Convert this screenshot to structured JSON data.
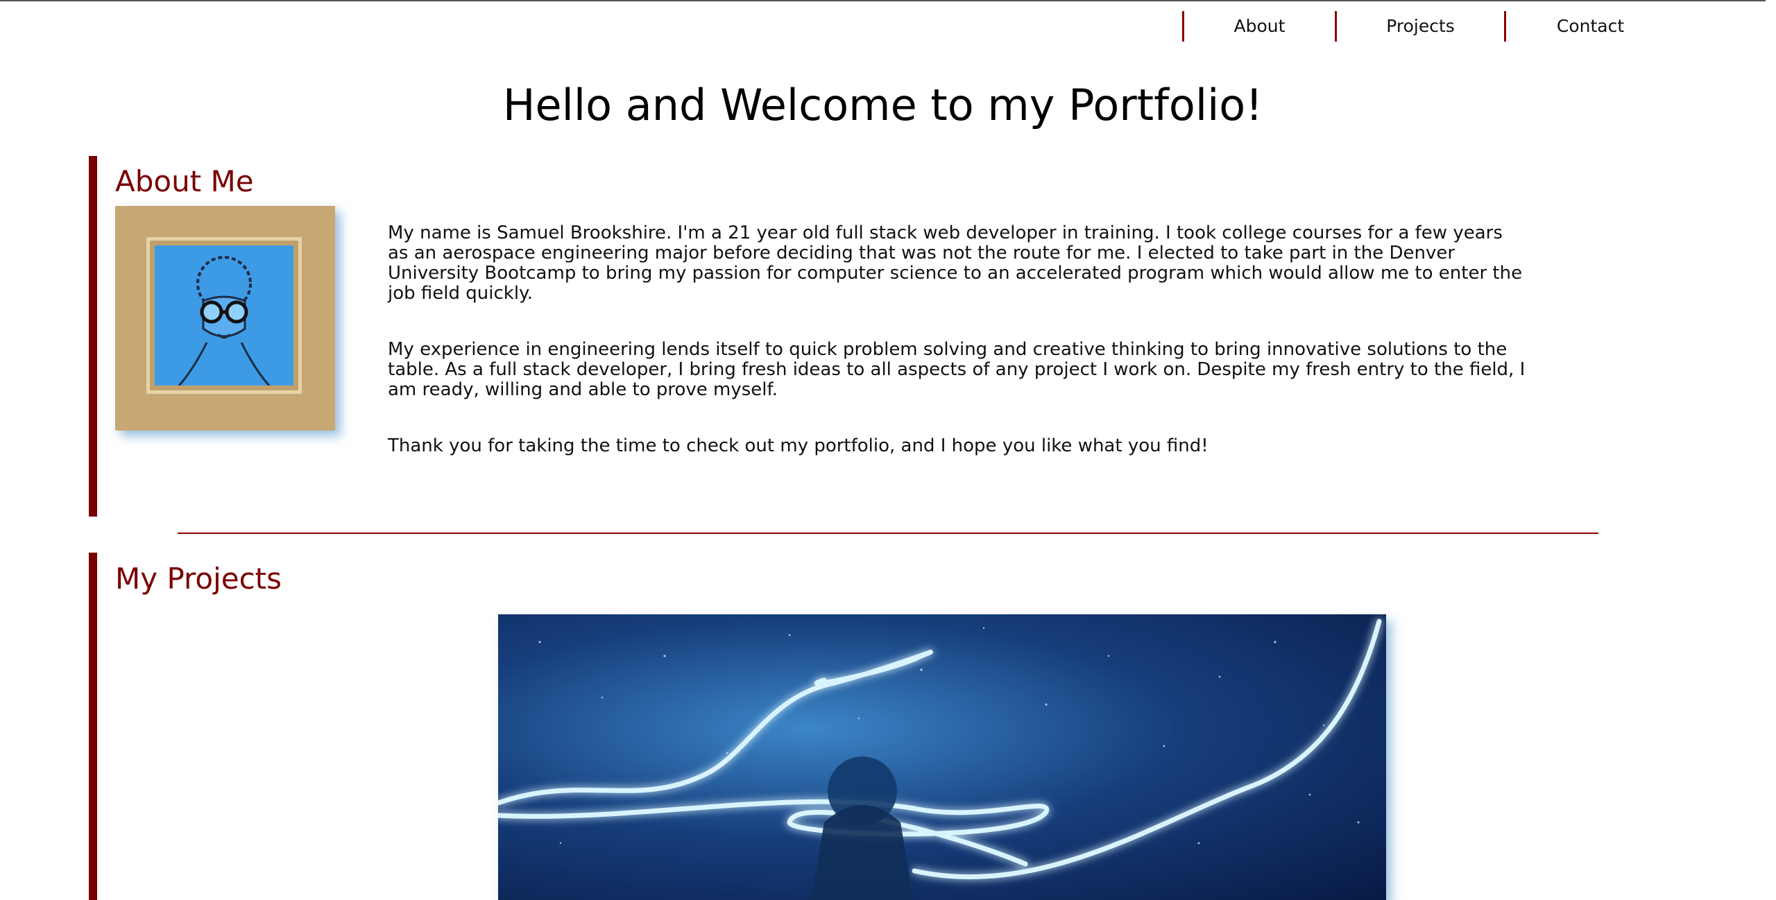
{
  "nav": {
    "links": [
      "About",
      "Projects",
      "Contact"
    ]
  },
  "page": {
    "title": "Hello and Welcome to my Portfolio!"
  },
  "about": {
    "heading": "About Me",
    "image_alt": "Sketch of a face wearing goggles painted on a blue tile",
    "paragraphs": [
      "My name is Samuel Brookshire. I'm a 21 year old full stack web developer in training. I took college courses for a few years as an aerospace engineering major before deciding that was not the route for me. I elected to take part in the Denver University Bootcamp to bring my passion for computer science to an accelerated program which would allow me to enter the job field quickly.",
      "My experience in engineering lends itself to quick problem solving and creative thinking to bring innovative solutions to the table. As a full stack developer, I bring fresh ideas to all aspects of any project I work on. Despite my fresh entry to the field, I am ready, willing and able to prove myself.",
      "Thank you for taking the time to check out my portfolio, and I hope you like what you find!"
    ]
  },
  "projects": {
    "heading": "My Projects",
    "image_alt": "Figure in space surrounded by glowing blue light trails"
  },
  "colors": {
    "accent": "#7a0000",
    "divider": "#8b0000",
    "text": "#111111",
    "background": "#ffffff"
  }
}
